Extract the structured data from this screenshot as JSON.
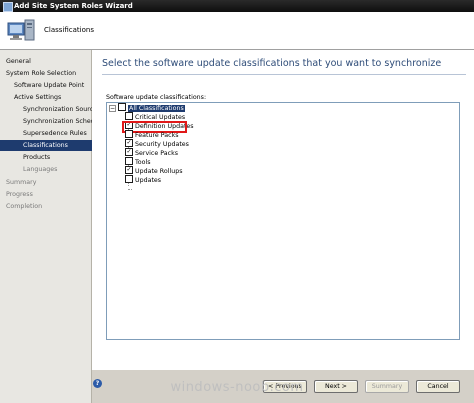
{
  "window": {
    "title": "Add Site System Roles Wizard"
  },
  "header": {
    "title": "Classifications",
    "icon": "computer-icon"
  },
  "sidebar": {
    "items": [
      {
        "label": "General",
        "state": "normal"
      },
      {
        "label": "System Role Selection",
        "state": "normal"
      },
      {
        "label": "Software Update Point",
        "state": "normal"
      },
      {
        "label": "Active Settings",
        "state": "normal"
      },
      {
        "label": "Synchronization Source",
        "state": "normal"
      },
      {
        "label": "Synchronization Schedule",
        "state": "normal"
      },
      {
        "label": "Supersedence Rules",
        "state": "normal"
      },
      {
        "label": "Classifications",
        "state": "selected"
      },
      {
        "label": "Products",
        "state": "normal"
      },
      {
        "label": "Languages",
        "state": "disabled"
      },
      {
        "label": "Summary",
        "state": "disabled"
      },
      {
        "label": "Progress",
        "state": "disabled"
      },
      {
        "label": "Completion",
        "state": "disabled"
      }
    ]
  },
  "main": {
    "heading": "Select the software update classifications that you want to synchronize",
    "list_label": "Software update classifications:",
    "tree": {
      "root": {
        "label": "All Classifications",
        "checked": false,
        "expanded": true
      },
      "items": [
        {
          "label": "Critical Updates",
          "checked": false
        },
        {
          "label": "Definition Updates",
          "checked": true
        },
        {
          "label": "Feature Packs",
          "checked": false
        },
        {
          "label": "Security Updates",
          "checked": true
        },
        {
          "label": "Service Packs",
          "checked": true
        },
        {
          "label": "Tools",
          "checked": false
        },
        {
          "label": "Update Rollups",
          "checked": true
        },
        {
          "label": "Updates",
          "checked": false
        }
      ]
    }
  },
  "footer": {
    "previous_label": "< Previous",
    "next_label": "Next >",
    "summary_label": "Summary",
    "cancel_label": "Cancel",
    "help_icon": "help-icon"
  },
  "watermark": "windows-noob.com",
  "colors": {
    "heading": "#2e4c78",
    "selected_nav": "#1e3b6e",
    "highlight": "#e01818"
  }
}
